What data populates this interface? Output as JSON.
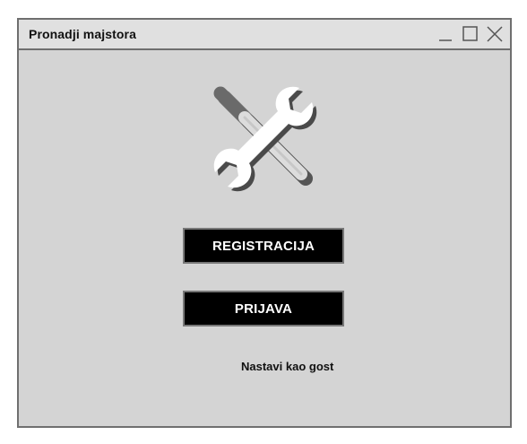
{
  "window": {
    "title": "Pronadji majstora",
    "controls": [
      "minimize-icon",
      "maximize-icon",
      "close-icon"
    ]
  },
  "logo": {
    "icon": "tools-wrench-screwdriver-icon"
  },
  "buttons": {
    "register_label": "REGISTRACIJA",
    "login_label": "PRIJAVA"
  },
  "guest_link": "Nastavi kao gost",
  "colors": {
    "window_bg": "#d4d4d4",
    "titlebar_bg": "#e0e0e0",
    "button_bg": "#000000",
    "button_text": "#ffffff",
    "border": "#6f6f6f"
  }
}
